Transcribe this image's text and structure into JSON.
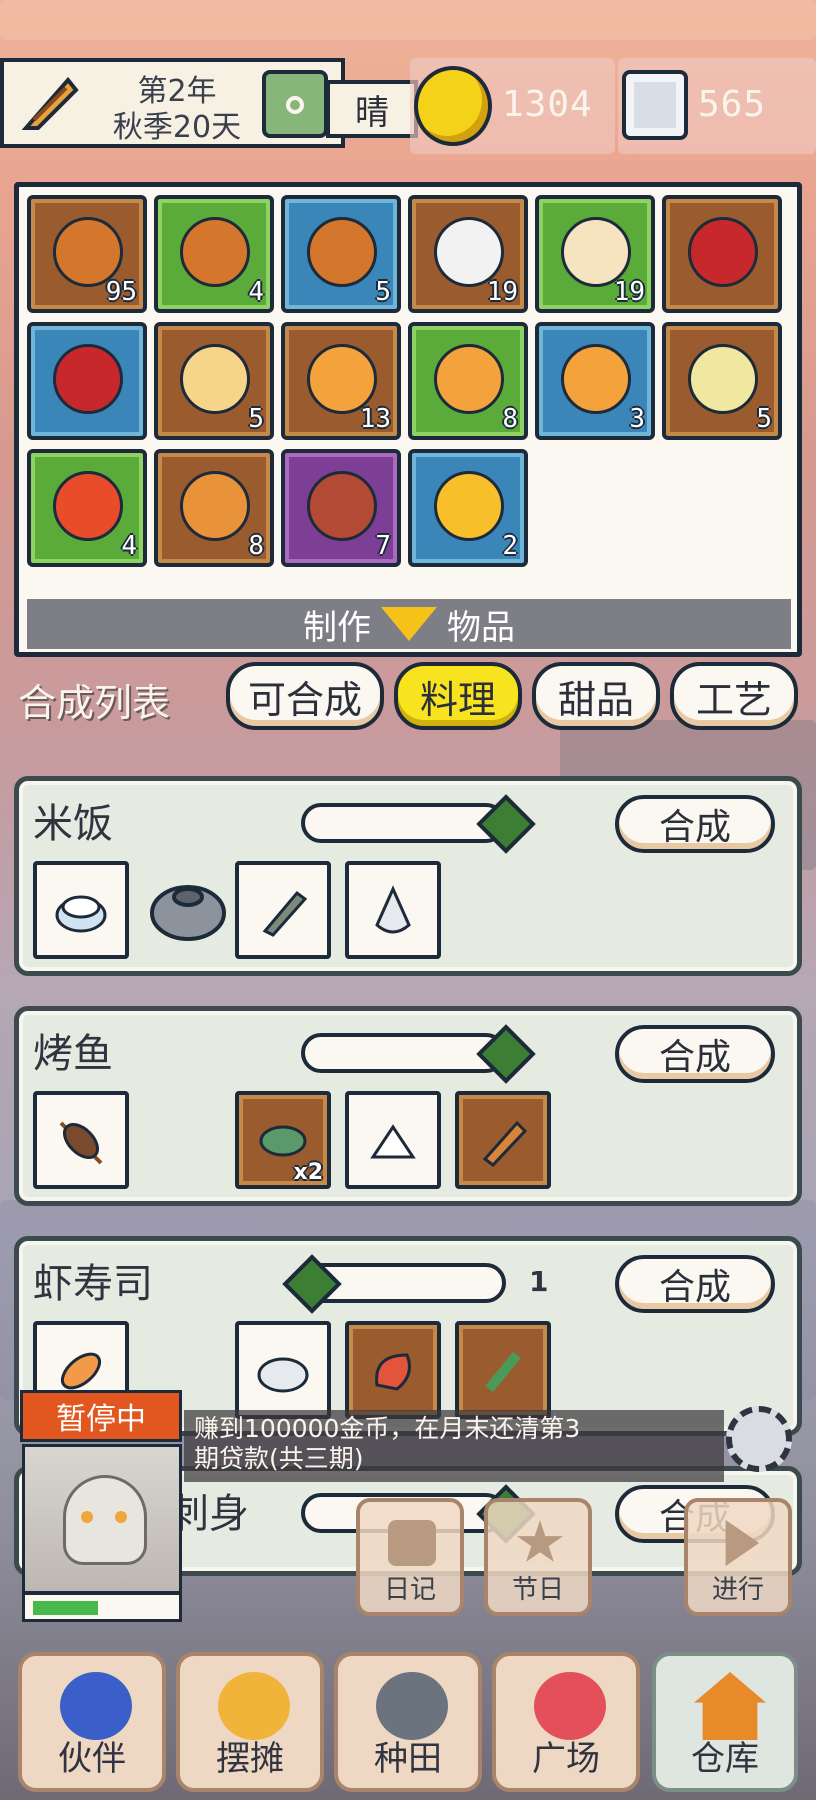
{
  "header": {
    "year": "第2年",
    "season_day": "秋季20天",
    "weather": "晴",
    "coins": "1304",
    "crystals": "565"
  },
  "inventory": {
    "items": [
      {
        "name": "vegetable-skewer",
        "count": "95",
        "bg": "brown"
      },
      {
        "name": "vegetable-skewer",
        "count": "4",
        "bg": "green"
      },
      {
        "name": "vegetable-skewer",
        "count": "5",
        "bg": "blue"
      },
      {
        "name": "milk",
        "count": "19",
        "bg": "brown"
      },
      {
        "name": "milk-bottle",
        "count": "19",
        "bg": "green"
      },
      {
        "name": "apple",
        "count": "",
        "bg": "brown"
      },
      {
        "name": "apple",
        "count": "",
        "bg": "blue"
      },
      {
        "name": "cheese",
        "count": "5",
        "bg": "brown"
      },
      {
        "name": "orange",
        "count": "13",
        "bg": "brown"
      },
      {
        "name": "orange",
        "count": "8",
        "bg": "green"
      },
      {
        "name": "orange",
        "count": "3",
        "bg": "blue"
      },
      {
        "name": "fruit-plate",
        "count": "5",
        "bg": "brown"
      },
      {
        "name": "fries",
        "count": "4",
        "bg": "green"
      },
      {
        "name": "melon-slice",
        "count": "8",
        "bg": "brown"
      },
      {
        "name": "steak",
        "count": "7",
        "bg": "purple"
      },
      {
        "name": "fried-egg",
        "count": "2",
        "bg": "blue"
      }
    ],
    "make_label": "制作",
    "items_label": "物品"
  },
  "tabs": {
    "title": "合成列表",
    "items": [
      "可合成",
      "料理",
      "甜品",
      "工艺"
    ]
  },
  "recipes": [
    {
      "name": "米饭",
      "button": "合成",
      "count": ""
    },
    {
      "name": "烤鱼",
      "button": "合成",
      "count": "",
      "fish_qty": "x2"
    },
    {
      "name": "虾寿司",
      "button": "合成",
      "count": "1"
    },
    {
      "name": "刺身",
      "button": "合成",
      "count": ""
    }
  ],
  "status": {
    "paused": "暂停中",
    "quest_line1": "赚到100000金币，在月末还清第3",
    "quest_line2": "期贷款(共三期)",
    "hp_fraction": 0.45
  },
  "shortcuts": [
    "日记",
    "节日",
    "进行"
  ],
  "nav": [
    "伙伴",
    "摆摊",
    "种田",
    "广场",
    "仓库"
  ],
  "colors": {
    "accent_yellow": "#f8e41e",
    "paused_orange": "#e2571f",
    "hp_green": "#47b84a"
  }
}
